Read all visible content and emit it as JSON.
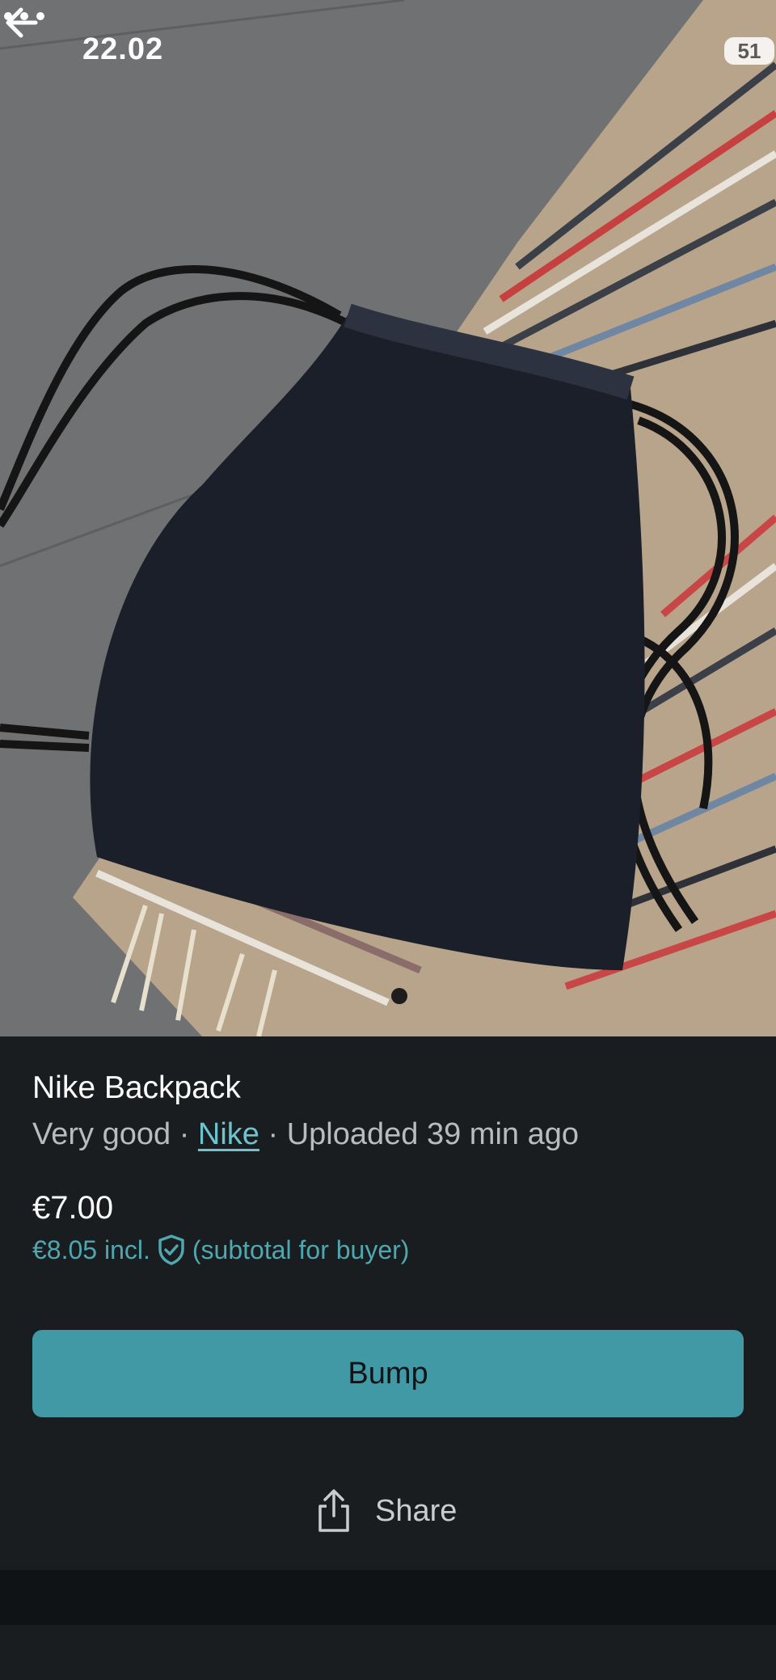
{
  "status_bar": {
    "time": "22.02",
    "battery": "51"
  },
  "listing": {
    "title": "Nike Backpack",
    "condition": "Very good",
    "brand": "Nike",
    "uploaded": "Uploaded 39 min ago",
    "price": "€7.00",
    "buyer_price": "€8.05 incl.",
    "buyer_note": "(subtotal for buyer)"
  },
  "actions": {
    "bump_label": "Bump",
    "share_label": "Share"
  },
  "colors": {
    "accent": "#4199a6",
    "panel_bg": "#1a1d1f",
    "link": "#6cc4cf"
  },
  "icons": [
    "back-arrow-icon",
    "more-dots-icon",
    "signal-icon",
    "wifi-icon",
    "battery-icon",
    "shield-check-icon",
    "share-icon"
  ]
}
